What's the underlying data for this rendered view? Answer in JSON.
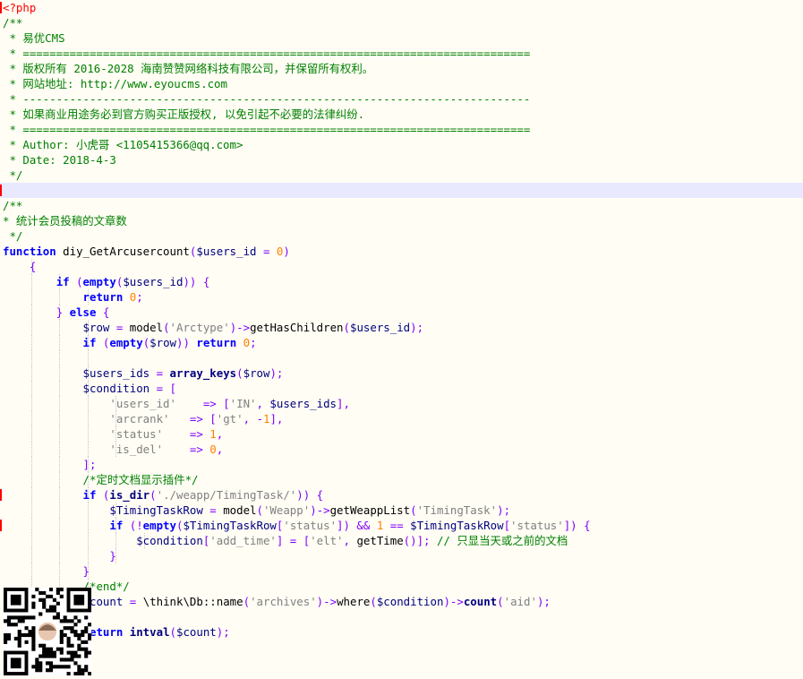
{
  "editor": {
    "language": "php",
    "current_line_index": 12,
    "colors": {
      "background": "#fffdf4",
      "current_line": "#e8e8ff",
      "comment": "#008000",
      "keyword": "#0000ff",
      "string": "#808080",
      "variable": "#000080",
      "number": "#ff8000",
      "operator": "#8000ff",
      "tag": "#ff0000",
      "gutter_marker": "#ff0000",
      "indent_guide": "#c8c8c8"
    },
    "lines": [
      {
        "indent": 0,
        "guides": [],
        "marker": true,
        "tokens": [
          {
            "t": "<?php",
            "k": "tag"
          }
        ]
      },
      {
        "indent": 0,
        "guides": [],
        "tokens": [
          {
            "t": "/**",
            "k": "comment"
          }
        ]
      },
      {
        "indent": 0,
        "guides": [],
        "tokens": [
          {
            "t": " * 易优CMS",
            "k": "comment"
          }
        ]
      },
      {
        "indent": 0,
        "guides": [],
        "tokens": [
          {
            "t": " * ============================================================================",
            "k": "comment"
          }
        ]
      },
      {
        "indent": 0,
        "guides": [],
        "tokens": [
          {
            "t": " * 版权所有 2016-2028 海南赞赞网络科技有限公司，并保留所有权利。",
            "k": "comment"
          }
        ]
      },
      {
        "indent": 0,
        "guides": [],
        "tokens": [
          {
            "t": " * 网站地址: http://www.eyoucms.com",
            "k": "comment"
          }
        ]
      },
      {
        "indent": 0,
        "guides": [],
        "tokens": [
          {
            "t": " * ----------------------------------------------------------------------------",
            "k": "comment"
          }
        ]
      },
      {
        "indent": 0,
        "guides": [],
        "tokens": [
          {
            "t": " * 如果商业用途务必到官方购买正版授权, 以免引起不必要的法律纠纷.",
            "k": "comment"
          }
        ]
      },
      {
        "indent": 0,
        "guides": [],
        "tokens": [
          {
            "t": " * ============================================================================",
            "k": "comment"
          }
        ]
      },
      {
        "indent": 0,
        "guides": [],
        "tokens": [
          {
            "t": " * Author: 小虎哥 <1105415366@qq.com>",
            "k": "comment"
          }
        ]
      },
      {
        "indent": 0,
        "guides": [],
        "tokens": [
          {
            "t": " * Date: 2018-4-3",
            "k": "comment"
          }
        ]
      },
      {
        "indent": 0,
        "guides": [],
        "tokens": [
          {
            "t": " */",
            "k": "comment"
          }
        ]
      },
      {
        "indent": 0,
        "guides": [],
        "marker": true,
        "tokens": []
      },
      {
        "indent": 0,
        "guides": [],
        "tokens": [
          {
            "t": "/**",
            "k": "comment"
          }
        ]
      },
      {
        "indent": 0,
        "guides": [],
        "tokens": [
          {
            "t": "* 统计会员投稿的文章数",
            "k": "comment"
          }
        ]
      },
      {
        "indent": 0,
        "guides": [],
        "tokens": [
          {
            "t": " */",
            "k": "comment"
          }
        ]
      },
      {
        "indent": 0,
        "guides": [],
        "tokens": [
          {
            "t": "function",
            "k": "keyword"
          },
          {
            "t": " diy_GetArcusercount",
            "k": "plain"
          },
          {
            "t": "(",
            "k": "operator"
          },
          {
            "t": "$users_id",
            "k": "variable"
          },
          {
            "t": " = ",
            "k": "operator"
          },
          {
            "t": "0",
            "k": "number"
          },
          {
            "t": ")",
            "k": "operator"
          }
        ]
      },
      {
        "indent": 0,
        "guides": [
          1
        ],
        "tokens": [
          {
            "t": "    {",
            "k": "operator"
          }
        ]
      },
      {
        "indent": 0,
        "guides": [
          1,
          2
        ],
        "tokens": [
          {
            "t": "        ",
            "k": "plain"
          },
          {
            "t": "if",
            "k": "keyword"
          },
          {
            "t": " (",
            "k": "operator"
          },
          {
            "t": "empty",
            "k": "keyword"
          },
          {
            "t": "(",
            "k": "operator"
          },
          {
            "t": "$users_id",
            "k": "variable"
          },
          {
            "t": ")) {",
            "k": "operator"
          }
        ]
      },
      {
        "indent": 0,
        "guides": [
          1,
          2,
          3
        ],
        "tokens": [
          {
            "t": "            ",
            "k": "plain"
          },
          {
            "t": "return",
            "k": "keyword"
          },
          {
            "t": " ",
            "k": "plain"
          },
          {
            "t": "0",
            "k": "number"
          },
          {
            "t": ";",
            "k": "operator"
          }
        ]
      },
      {
        "indent": 0,
        "guides": [
          1,
          2
        ],
        "tokens": [
          {
            "t": "        ",
            "k": "plain"
          },
          {
            "t": "} ",
            "k": "operator"
          },
          {
            "t": "else",
            "k": "keyword"
          },
          {
            "t": " {",
            "k": "operator"
          }
        ]
      },
      {
        "indent": 0,
        "guides": [
          1,
          2,
          3
        ],
        "tokens": [
          {
            "t": "            ",
            "k": "plain"
          },
          {
            "t": "$row",
            "k": "variable"
          },
          {
            "t": " = ",
            "k": "operator"
          },
          {
            "t": "model",
            "k": "plain"
          },
          {
            "t": "(",
            "k": "operator"
          },
          {
            "t": "'Arctype'",
            "k": "string"
          },
          {
            "t": ")->",
            "k": "operator"
          },
          {
            "t": "getHasChildren",
            "k": "plain"
          },
          {
            "t": "(",
            "k": "operator"
          },
          {
            "t": "$users_id",
            "k": "variable"
          },
          {
            "t": ");",
            "k": "operator"
          }
        ]
      },
      {
        "indent": 0,
        "guides": [
          1,
          2,
          3
        ],
        "tokens": [
          {
            "t": "            ",
            "k": "plain"
          },
          {
            "t": "if",
            "k": "keyword"
          },
          {
            "t": " (",
            "k": "operator"
          },
          {
            "t": "empty",
            "k": "keyword"
          },
          {
            "t": "(",
            "k": "operator"
          },
          {
            "t": "$row",
            "k": "variable"
          },
          {
            "t": ")) ",
            "k": "operator"
          },
          {
            "t": "return",
            "k": "keyword"
          },
          {
            "t": " ",
            "k": "plain"
          },
          {
            "t": "0",
            "k": "number"
          },
          {
            "t": ";",
            "k": "operator"
          }
        ]
      },
      {
        "indent": 0,
        "guides": [
          1,
          2,
          3
        ],
        "tokens": []
      },
      {
        "indent": 0,
        "guides": [
          1,
          2,
          3
        ],
        "tokens": [
          {
            "t": "            ",
            "k": "plain"
          },
          {
            "t": "$users_ids",
            "k": "variable"
          },
          {
            "t": " = ",
            "k": "operator"
          },
          {
            "t": "array_keys",
            "k": "builtin"
          },
          {
            "t": "(",
            "k": "operator"
          },
          {
            "t": "$row",
            "k": "variable"
          },
          {
            "t": ");",
            "k": "operator"
          }
        ]
      },
      {
        "indent": 0,
        "guides": [
          1,
          2,
          3
        ],
        "tokens": [
          {
            "t": "            ",
            "k": "plain"
          },
          {
            "t": "$condition",
            "k": "variable"
          },
          {
            "t": " = [",
            "k": "operator"
          }
        ]
      },
      {
        "indent": 0,
        "guides": [
          1,
          2,
          3,
          4
        ],
        "tokens": [
          {
            "t": "                ",
            "k": "plain"
          },
          {
            "t": "'users_id'",
            "k": "string"
          },
          {
            "t": "    ",
            "k": "plain"
          },
          {
            "t": "=>",
            "k": "operator"
          },
          {
            "t": " [",
            "k": "operator"
          },
          {
            "t": "'IN'",
            "k": "string"
          },
          {
            "t": ", ",
            "k": "operator"
          },
          {
            "t": "$users_ids",
            "k": "variable"
          },
          {
            "t": "],",
            "k": "operator"
          }
        ]
      },
      {
        "indent": 0,
        "guides": [
          1,
          2,
          3,
          4
        ],
        "tokens": [
          {
            "t": "                ",
            "k": "plain"
          },
          {
            "t": "'arcrank'",
            "k": "string"
          },
          {
            "t": "   ",
            "k": "plain"
          },
          {
            "t": "=>",
            "k": "operator"
          },
          {
            "t": " [",
            "k": "operator"
          },
          {
            "t": "'gt'",
            "k": "string"
          },
          {
            "t": ", -",
            "k": "operator"
          },
          {
            "t": "1",
            "k": "number"
          },
          {
            "t": "],",
            "k": "operator"
          }
        ]
      },
      {
        "indent": 0,
        "guides": [
          1,
          2,
          3,
          4
        ],
        "tokens": [
          {
            "t": "                ",
            "k": "plain"
          },
          {
            "t": "'status'",
            "k": "string"
          },
          {
            "t": "    ",
            "k": "plain"
          },
          {
            "t": "=>",
            "k": "operator"
          },
          {
            "t": " ",
            "k": "plain"
          },
          {
            "t": "1",
            "k": "number"
          },
          {
            "t": ",",
            "k": "operator"
          }
        ]
      },
      {
        "indent": 0,
        "guides": [
          1,
          2,
          3,
          4
        ],
        "tokens": [
          {
            "t": "                ",
            "k": "plain"
          },
          {
            "t": "'is_del'",
            "k": "string"
          },
          {
            "t": "    ",
            "k": "plain"
          },
          {
            "t": "=>",
            "k": "operator"
          },
          {
            "t": " ",
            "k": "plain"
          },
          {
            "t": "0",
            "k": "number"
          },
          {
            "t": ",",
            "k": "operator"
          }
        ]
      },
      {
        "indent": 0,
        "guides": [
          1,
          2,
          3
        ],
        "tokens": [
          {
            "t": "            ",
            "k": "plain"
          },
          {
            "t": "];",
            "k": "operator"
          }
        ]
      },
      {
        "indent": 0,
        "guides": [
          1,
          2,
          3
        ],
        "tokens": [
          {
            "t": "            ",
            "k": "plain"
          },
          {
            "t": "/*定时文档显示插件*/",
            "k": "comment"
          }
        ]
      },
      {
        "indent": 0,
        "guides": [
          1,
          2,
          3
        ],
        "marker": true,
        "tokens": [
          {
            "t": "            ",
            "k": "plain"
          },
          {
            "t": "if",
            "k": "keyword"
          },
          {
            "t": " (",
            "k": "operator"
          },
          {
            "t": "is_dir",
            "k": "builtin"
          },
          {
            "t": "(",
            "k": "operator"
          },
          {
            "t": "'./weapp/TimingTask/'",
            "k": "string"
          },
          {
            "t": ")) {",
            "k": "operator"
          }
        ]
      },
      {
        "indent": 0,
        "guides": [
          1,
          2,
          3,
          4
        ],
        "tokens": [
          {
            "t": "                ",
            "k": "plain"
          },
          {
            "t": "$TimingTaskRow",
            "k": "variable"
          },
          {
            "t": " = ",
            "k": "operator"
          },
          {
            "t": "model",
            "k": "plain"
          },
          {
            "t": "(",
            "k": "operator"
          },
          {
            "t": "'Weapp'",
            "k": "string"
          },
          {
            "t": ")->",
            "k": "operator"
          },
          {
            "t": "getWeappList",
            "k": "plain"
          },
          {
            "t": "(",
            "k": "operator"
          },
          {
            "t": "'TimingTask'",
            "k": "string"
          },
          {
            "t": ");",
            "k": "operator"
          }
        ]
      },
      {
        "indent": 0,
        "guides": [
          1,
          2,
          3,
          4
        ],
        "marker": true,
        "tokens": [
          {
            "t": "                ",
            "k": "plain"
          },
          {
            "t": "if",
            "k": "keyword"
          },
          {
            "t": " (!",
            "k": "operator"
          },
          {
            "t": "empty",
            "k": "keyword"
          },
          {
            "t": "(",
            "k": "operator"
          },
          {
            "t": "$TimingTaskRow",
            "k": "variable"
          },
          {
            "t": "[",
            "k": "operator"
          },
          {
            "t": "'status'",
            "k": "string"
          },
          {
            "t": "]) && ",
            "k": "operator"
          },
          {
            "t": "1",
            "k": "number"
          },
          {
            "t": " == ",
            "k": "operator"
          },
          {
            "t": "$TimingTaskRow",
            "k": "variable"
          },
          {
            "t": "[",
            "k": "operator"
          },
          {
            "t": "'status'",
            "k": "string"
          },
          {
            "t": "]) {",
            "k": "operator"
          }
        ]
      },
      {
        "indent": 0,
        "guides": [
          1,
          2,
          3,
          4,
          5
        ],
        "tokens": [
          {
            "t": "                    ",
            "k": "plain"
          },
          {
            "t": "$condition",
            "k": "variable"
          },
          {
            "t": "[",
            "k": "operator"
          },
          {
            "t": "'add_time'",
            "k": "string"
          },
          {
            "t": "] = [",
            "k": "operator"
          },
          {
            "t": "'elt'",
            "k": "string"
          },
          {
            "t": ", ",
            "k": "operator"
          },
          {
            "t": "getTime",
            "k": "plain"
          },
          {
            "t": "()]; ",
            "k": "operator"
          },
          {
            "t": "// 只显当天或之前的文档",
            "k": "comment"
          }
        ]
      },
      {
        "indent": 0,
        "guides": [
          1,
          2,
          3,
          4
        ],
        "tokens": [
          {
            "t": "                ",
            "k": "plain"
          },
          {
            "t": "}",
            "k": "operator"
          }
        ]
      },
      {
        "indent": 0,
        "guides": [
          1,
          2,
          3
        ],
        "tokens": [
          {
            "t": "            ",
            "k": "plain"
          },
          {
            "t": "}",
            "k": "operator"
          }
        ]
      },
      {
        "indent": 0,
        "guides": [
          1,
          2,
          3
        ],
        "tokens": [
          {
            "t": "            ",
            "k": "plain"
          },
          {
            "t": "/*end*/",
            "k": "comment"
          }
        ]
      },
      {
        "indent": 0,
        "guides": [
          1,
          2,
          3
        ],
        "tokens": [
          {
            "t": "             ",
            "k": "plain"
          },
          {
            "t": "count",
            "k": "variable"
          },
          {
            "t": " = ",
            "k": "operator"
          },
          {
            "t": "\\think\\Db::",
            "k": "plain"
          },
          {
            "t": "name",
            "k": "plain"
          },
          {
            "t": "(",
            "k": "operator"
          },
          {
            "t": "'archives'",
            "k": "string"
          },
          {
            "t": ")->",
            "k": "operator"
          },
          {
            "t": "where",
            "k": "plain"
          },
          {
            "t": "(",
            "k": "operator"
          },
          {
            "t": "$condition",
            "k": "variable"
          },
          {
            "t": ")->",
            "k": "operator"
          },
          {
            "t": "count",
            "k": "builtin"
          },
          {
            "t": "(",
            "k": "operator"
          },
          {
            "t": "'aid'",
            "k": "string"
          },
          {
            "t": ");",
            "k": "operator"
          }
        ]
      },
      {
        "indent": 0,
        "guides": [],
        "tokens": []
      },
      {
        "indent": 0,
        "guides": [],
        "tokens": [
          {
            "t": "             ",
            "k": "plain"
          },
          {
            "t": "eturn",
            "k": "keyword"
          },
          {
            "t": " ",
            "k": "plain"
          },
          {
            "t": "intval",
            "k": "builtin"
          },
          {
            "t": "(",
            "k": "operator"
          },
          {
            "t": "$count",
            "k": "variable"
          },
          {
            "t": ");",
            "k": "operator"
          }
        ]
      }
    ]
  }
}
